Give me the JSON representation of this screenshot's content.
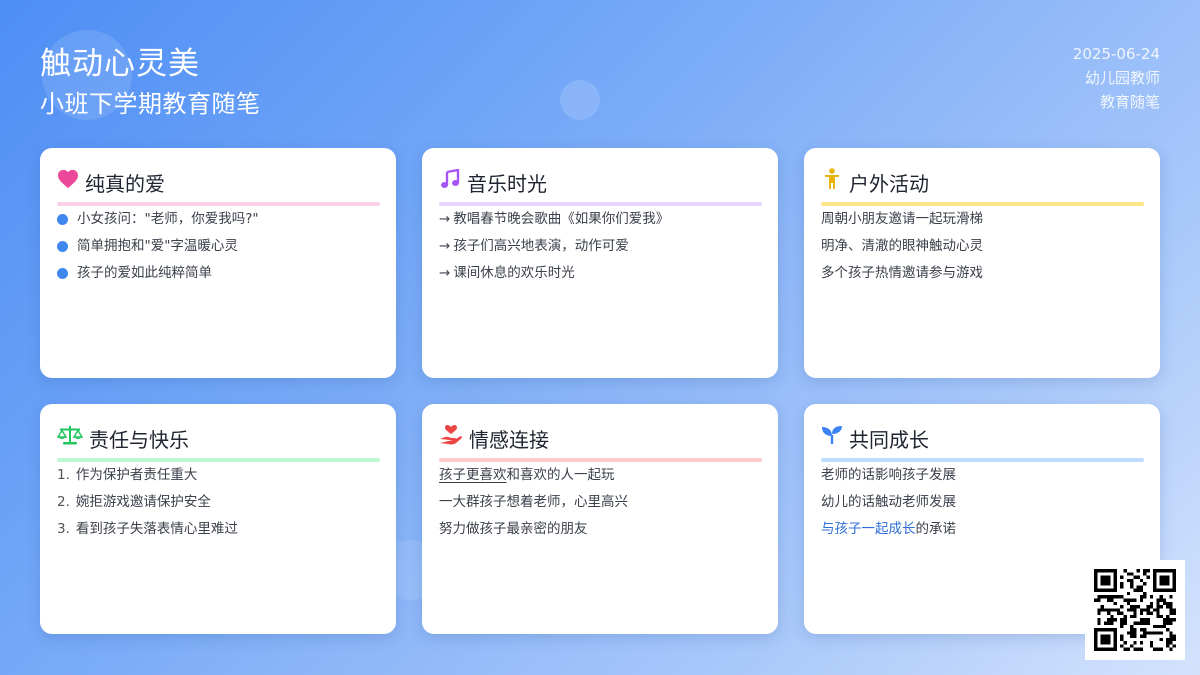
{
  "header": {
    "title": "触动心灵美",
    "subtitle": "小班下学期教育随笔",
    "date": "2025-06-24",
    "author": "幼儿园教师",
    "category": "教育随笔"
  },
  "cards": [
    {
      "title": "纯真的爱",
      "icon": "heart-icon",
      "accent": "#ec4899",
      "underline": "#fbcfe8",
      "style": "bullet",
      "items": [
        "小女孩问：\"老师，你爱我吗?\"",
        "简单拥抱和\"爱\"字温暖心灵",
        "孩子的爱如此纯粹简单"
      ]
    },
    {
      "title": "音乐时光",
      "icon": "music-note-icon",
      "accent": "#a855f7",
      "underline": "#e9d5ff",
      "style": "arrow",
      "prefix": "→",
      "items": [
        "教唱春节晚会歌曲《如果你们爱我》",
        "孩子们高兴地表演，动作可爱",
        "课间休息的欢乐时光"
      ]
    },
    {
      "title": "户外活动",
      "icon": "child-icon",
      "accent": "#eab308",
      "underline": "#fde68a",
      "style": "plain",
      "items": [
        "周朝小朋友邀请一起玩滑梯",
        "明净、清澈的眼神触动心灵",
        "多个孩子热情邀请参与游戏"
      ]
    },
    {
      "title": "责任与快乐",
      "icon": "balance-scale-icon",
      "accent": "#22c55e",
      "underline": "#bbf7d0",
      "style": "numbered",
      "numbers": [
        "1.",
        "2.",
        "3."
      ],
      "items": [
        "作为保护者责任重大",
        "婉拒游戏邀请保护安全",
        "看到孩子失落表情心里难过"
      ]
    },
    {
      "title": "情感连接",
      "icon": "hand-heart-icon",
      "accent": "#ef4444",
      "underline": "#fecaca",
      "style": "plain",
      "items": [
        "孩子更喜欢和喜欢的人一起玩",
        "一大群孩子想着老师，心里高兴",
        "努力做孩子最亲密的朋友"
      ],
      "first_underlined": "孩子更喜欢",
      "first_rest": "和喜欢的人一起玩"
    },
    {
      "title": "共同成长",
      "icon": "seedling-icon",
      "accent": "#3b82f6",
      "underline": "#bfdbfe",
      "style": "plain",
      "items": [
        "老师的话影响孩子发展",
        "幼儿的话触动老师发展",
        "与孩子一起成长的承诺"
      ],
      "last_blue": "与孩子一起成长",
      "last_rest": "的承诺"
    }
  ]
}
